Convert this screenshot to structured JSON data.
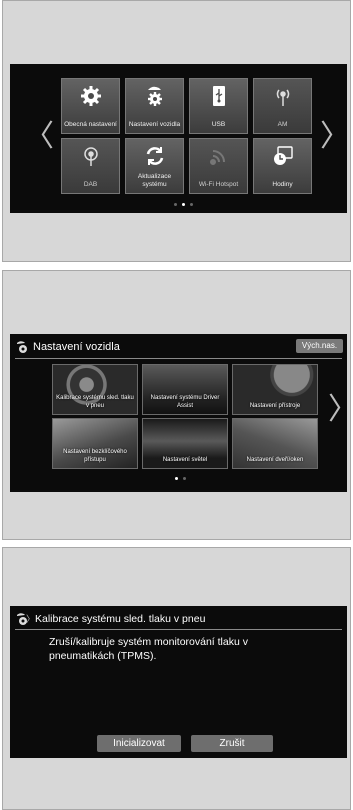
{
  "main_menu": {
    "tiles": [
      {
        "label": "Obecná nastavení",
        "icon": "gear-icon"
      },
      {
        "label": "Nastavení vozidla",
        "icon": "vehicle-settings-icon"
      },
      {
        "label": "USB",
        "icon": "usb-icon"
      },
      {
        "label": "AM",
        "icon": "radio-antenna-icon"
      },
      {
        "label": "DAB",
        "icon": "dab-antenna-icon"
      },
      {
        "label": "Aktualizace systému",
        "icon": "refresh-icon"
      },
      {
        "label": "Wi-Fi Hotspot",
        "icon": "wifi-icon"
      },
      {
        "label": "Hodiny",
        "icon": "clock-icon"
      }
    ],
    "prev_arrow": "〈",
    "next_arrow": "〉",
    "pages": 3,
    "current_page": 2
  },
  "vehicle_settings": {
    "title": "Nastavení vozidla",
    "default_button": "Vých.nas.",
    "cards": [
      {
        "label": "Kalibrace systému sled. tlaku v pneu"
      },
      {
        "label": "Nastavení systému Driver Assist"
      },
      {
        "label": "Nastavení přístroje"
      },
      {
        "label": "Nastavení bezklíčového přístupu"
      },
      {
        "label": "Nastavení světel"
      },
      {
        "label": "Nastavení dveří/oken"
      }
    ],
    "next_arrow": "〉",
    "pages": 2,
    "current_page": 1
  },
  "tpms": {
    "breadcrumb_sep": "〉",
    "title": "Kalibrace systému sled. tlaku v pneu",
    "body": "Zruší/kalibruje systém monitorování tlaku v pneumatikách (TPMS).",
    "init_button": "Inicializovat",
    "cancel_button": "Zrušit"
  }
}
